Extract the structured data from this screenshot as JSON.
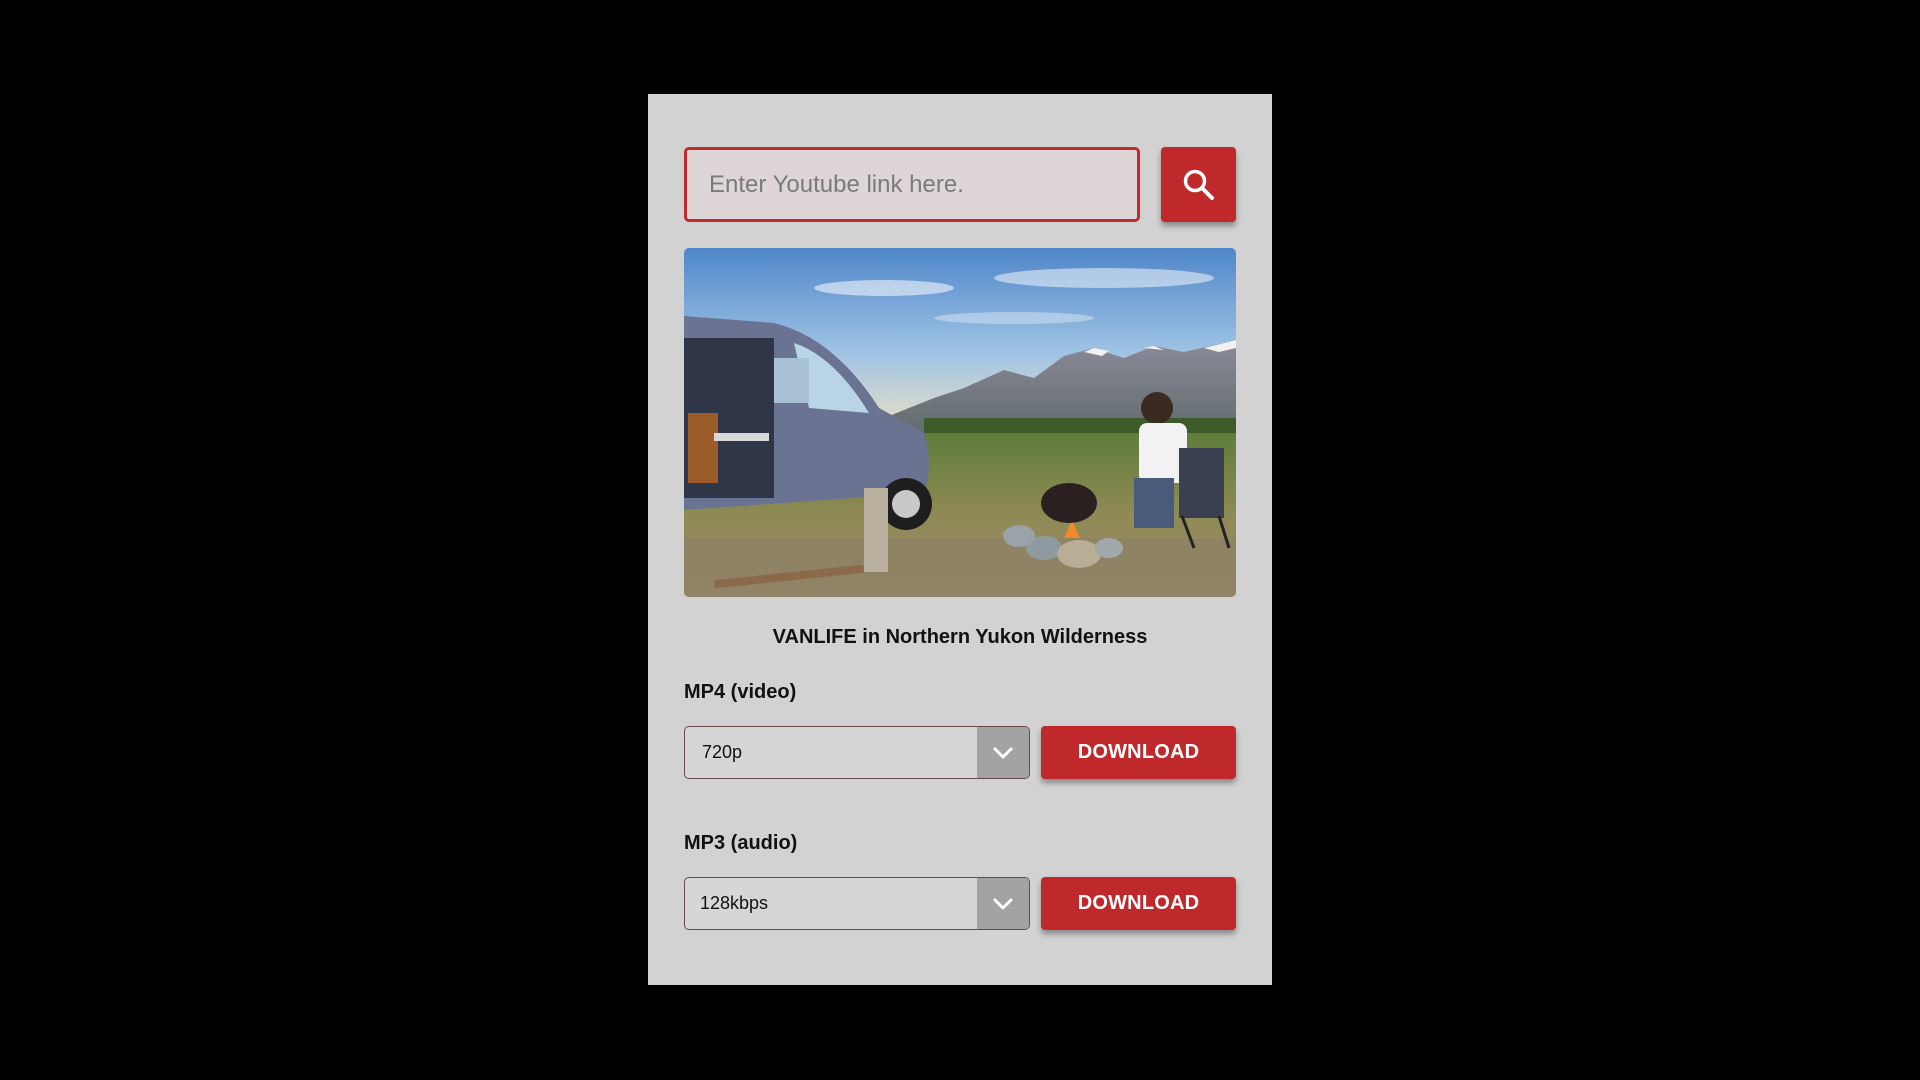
{
  "search": {
    "placeholder": "Enter Youtube link here.",
    "value": "",
    "button_icon": "search-icon"
  },
  "video": {
    "thumbnail_alt": "van-camping-scene",
    "title": "VANLIFE in Northern Yukon Wilderness"
  },
  "mp4": {
    "label": "MP4 (video)",
    "selected": "720p",
    "download_label": "DOWNLOAD"
  },
  "mp3": {
    "label": "MP3 (audio)",
    "selected": "128kbps",
    "download_label": "DOWNLOAD"
  },
  "colors": {
    "accent": "#c0292b",
    "card_background": "#d2d2d2",
    "page_background": "#000000"
  }
}
